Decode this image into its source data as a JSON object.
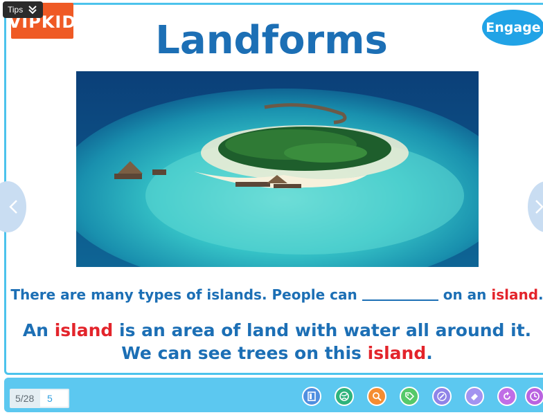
{
  "tips": {
    "label": "Tips",
    "icon": "chevron-double-down-icon"
  },
  "logo": {
    "text": "VIPKID"
  },
  "slide": {
    "title": "Landforms",
    "engage_label": "Engage",
    "sentence1": {
      "before": "There are many types of islands. People can",
      "after": "on an",
      "highlight": "island",
      "end": "."
    },
    "sentence2": {
      "before": "An",
      "highlight": "island",
      "after": "is an area of land with water all around it."
    },
    "sentence3": {
      "before": "We can see trees on this",
      "highlight": "island",
      "end": "."
    }
  },
  "toolbar": {
    "page_total": "5/28",
    "page_current": "5",
    "tools": [
      {
        "name": "whiteboard-tool",
        "icon": "board-icon",
        "color": "#4f8fe0"
      },
      {
        "name": "globe-tool",
        "icon": "globe-icon",
        "color": "#2eb37c"
      },
      {
        "name": "search-tool",
        "icon": "magnifier-icon",
        "color": "#f58d31"
      },
      {
        "name": "tag-tool",
        "icon": "tag-icon",
        "color": "#56c96a"
      },
      {
        "name": "draw-tool",
        "icon": "pen-icon",
        "color": "#8f84e8"
      },
      {
        "name": "eraser-tool",
        "icon": "eraser-icon",
        "color": "#a393f0"
      },
      {
        "name": "reset-tool",
        "icon": "refresh-icon",
        "color": "#c06ee6"
      },
      {
        "name": "timer-tool",
        "icon": "clock-icon",
        "color": "#b963e0"
      }
    ]
  },
  "colors": {
    "accent_blue": "#1c6fb5",
    "highlight_red": "#e3242b",
    "frame_blue": "#4cc3ec",
    "logo_orange": "#ef5a25",
    "engage_blue": "#21a3e6"
  }
}
